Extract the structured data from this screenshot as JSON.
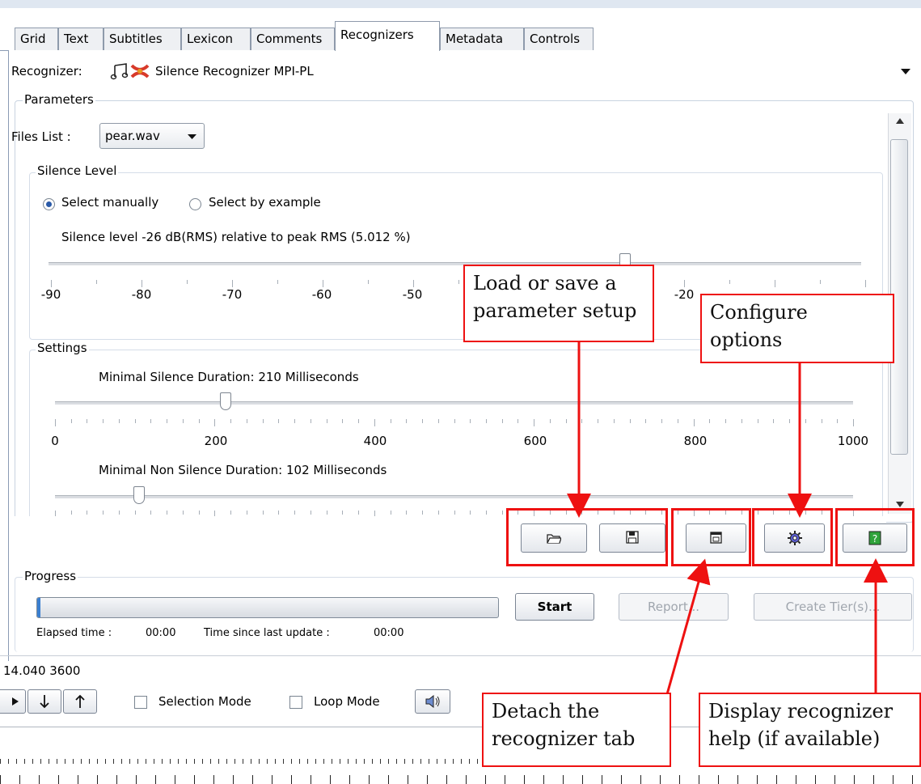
{
  "tabs": [
    "Grid",
    "Text",
    "Subtitles",
    "Lexicon",
    "Comments",
    "Recognizers",
    "Metadata",
    "Controls"
  ],
  "recognizer": {
    "label": "Recognizer:",
    "selected": "Silence Recognizer MPI-PL"
  },
  "parameters": {
    "title": "Parameters",
    "files_label": "Files List :",
    "file_selected": "pear.wav",
    "silence_level": {
      "title": "Silence Level",
      "radio_manual": "Select manually",
      "radio_example": "Select by example",
      "status": "Silence level -26 dB(RMS) relative to peak RMS (5.012 %)",
      "value": -26,
      "ticks": [
        "-90",
        "-80",
        "-70",
        "-60",
        "-50",
        "-20"
      ]
    },
    "settings": {
      "title": "Settings",
      "min_silence_label": "Minimal Silence Duration: 210 Milliseconds",
      "min_silence_value": 210,
      "min_nonsilence_label": "Minimal Non Silence Duration: 102 Milliseconds",
      "min_nonsilence_value": 102,
      "ticks": [
        "0",
        "200",
        "400",
        "600",
        "800",
        "1000"
      ]
    }
  },
  "toolbar_icons": [
    "folder-icon",
    "floppy-icon",
    "detach-icon",
    "gear-icon",
    "help-icon"
  ],
  "progress": {
    "title": "Progress",
    "value": 0,
    "start": "Start",
    "report": "Report...",
    "create_tiers": "Create Tier(s)...",
    "elapsed_label": "Elapsed time :",
    "elapsed_value": "00:00",
    "since_label": "Time since last update :",
    "since_value": "00:00"
  },
  "bottom": {
    "time_readout": "14.040  3600",
    "selection_mode": "Selection Mode",
    "loop_mode": "Loop Mode"
  },
  "callouts": {
    "load_save": "Load or save a parameter setup",
    "configure": "Configure options",
    "detach": "Detach the recognizer tab",
    "help": "Display recognizer help (if available)"
  },
  "colors": {
    "annotation_red": "#ee1111",
    "progress_fill": "#3a7fd0",
    "tab_border": "#8a9bb4"
  }
}
